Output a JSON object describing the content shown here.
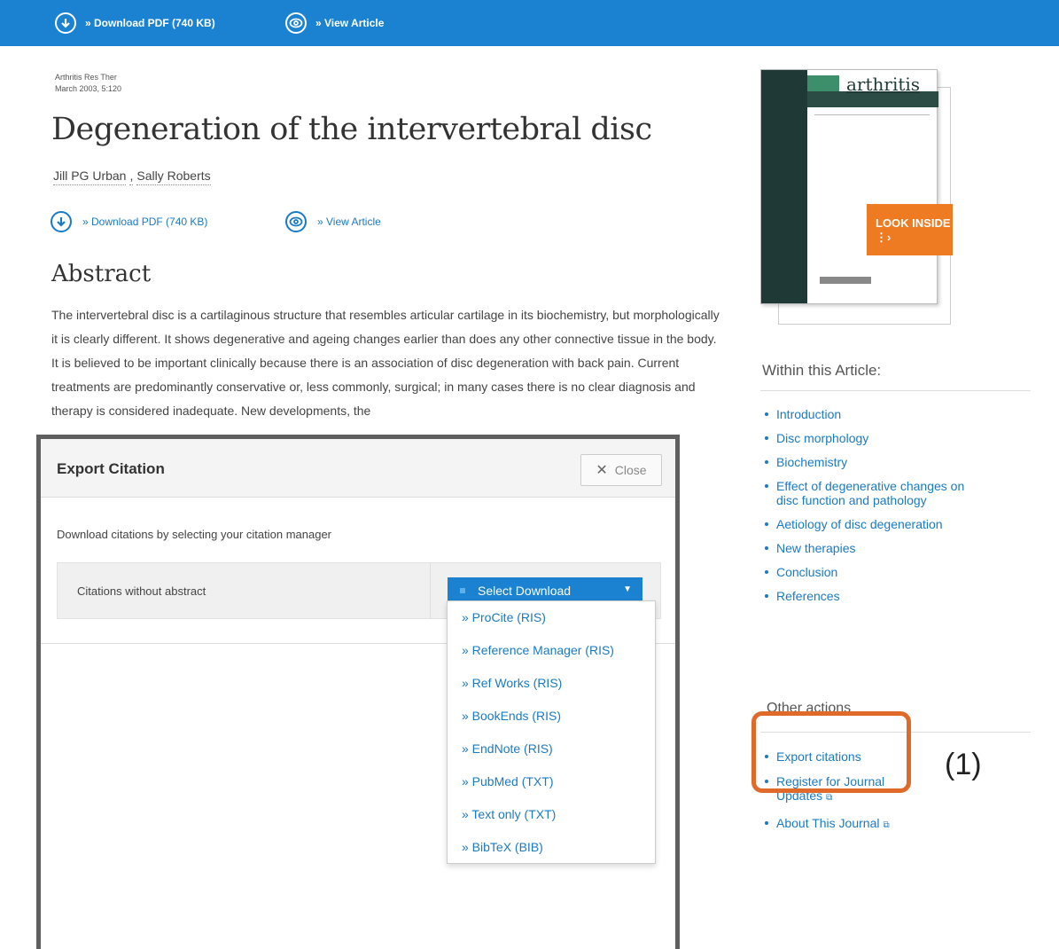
{
  "topbar": {
    "download_label": "» Download PDF (740 KB)",
    "view_label": "» View Article",
    "color": "#1a82d0"
  },
  "journal": {
    "name": "Arthritis Res Ther",
    "date": "March 2003, 5:120"
  },
  "article": {
    "title": "Degeneration of the intervertebral disc",
    "authors": [
      "Jill PG Urban",
      "Sally Roberts"
    ],
    "download_label": "» Download PDF (740 KB)",
    "view_label": "» View Article"
  },
  "abstract": {
    "heading": "Abstract",
    "text": "The intervertebral disc is a cartilaginous structure that resembles articular cartilage in its biochemistry, but morphologically it is clearly different. It shows degenerative and ageing changes earlier than does any other connective tissue in the body. It is believed to be important clinically because there is an association of disc degeneration with back pain. Current treatments are predominantly conservative or, less commonly, surgical; in many cases there is no clear diagnosis and therapy is considered inadequate. New developments, the"
  },
  "cover": {
    "title": "arthritis",
    "look_inside": "LOOK INSIDE",
    "accent": "#ee7a22"
  },
  "within_article": {
    "heading": "Within this Article:",
    "items": [
      "Introduction",
      "Disc morphology",
      "Biochemistry",
      "Effect of degenerative changes on disc function and pathology",
      "Aetiology of disc degeneration",
      "New therapies",
      "Conclusion",
      "References"
    ]
  },
  "other_actions": {
    "heading": "Other actions",
    "export": "Export citations",
    "register": "Register for Journal Updates",
    "about": "About This Journal",
    "ext_icon": "external-link-icon"
  },
  "callout": {
    "label": "(1)",
    "color": "#e06a2a"
  },
  "modal": {
    "title": "Export Citation",
    "close": "Close",
    "instructions": "Download citations by selecting your citation manager",
    "row_label": "Citations without abstract",
    "select_label": "Select Download",
    "options": [
      "» ProCite (RIS)",
      "» Reference Manager (RIS)",
      "» Ref Works (RIS)",
      "» BookEnds (RIS)",
      "» EndNote (RIS)",
      "» PubMed (TXT)",
      "» Text only (TXT)",
      "» BibTeX (BIB)"
    ]
  }
}
